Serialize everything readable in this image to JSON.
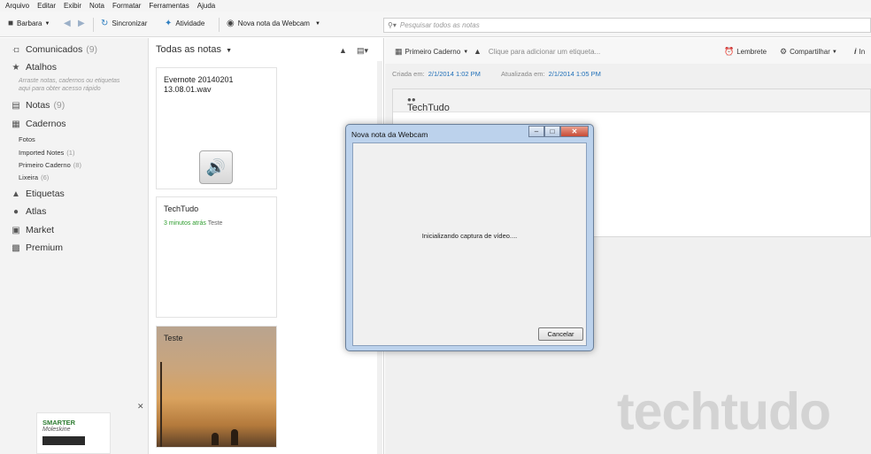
{
  "menu": [
    "Arquivo",
    "Editar",
    "Exibir",
    "Nota",
    "Formatar",
    "Ferramentas",
    "Ajuda"
  ],
  "toolbar": {
    "user": "Barbara",
    "sync": "Sincronizar",
    "activity": "Atividade",
    "webcam_note": "Nova nota da Webcam",
    "search_placeholder": "Pesquisar todos as notas"
  },
  "sidebar": {
    "comunicados": {
      "label": "Comunicados",
      "count": "(9)"
    },
    "atalhos": {
      "label": "Atalhos",
      "hint": "Arraste notas, cadernos ou etiquetas aqui para obter acesso rápido"
    },
    "notas": {
      "label": "Notas",
      "count": "(9)"
    },
    "cadernos": {
      "label": "Cadernos"
    },
    "notebooks": [
      {
        "label": "Fotos",
        "count": ""
      },
      {
        "label": "Imported Notes",
        "count": "(1)"
      },
      {
        "label": "Primeiro Caderno",
        "count": "(8)"
      },
      {
        "label": "Lixeira",
        "count": "(6)"
      }
    ],
    "etiquetas": {
      "label": "Etiquetas"
    },
    "atlas": {
      "label": "Atlas"
    },
    "market": {
      "label": "Market"
    },
    "premium": {
      "label": "Premium"
    },
    "promo": {
      "line1": "SMARTER",
      "line2": "Moleskine"
    }
  },
  "notelist": {
    "title": "Todas as notas",
    "notes": [
      {
        "title": "Evernote 20140201 13.08.01.wav",
        "meta_time": "",
        "meta_text": ""
      },
      {
        "title": "TechTudo",
        "meta_time": "3 minutos atrás",
        "meta_text": "Teste"
      },
      {
        "title": "Teste",
        "meta_time": "",
        "meta_text": ""
      }
    ]
  },
  "editor": {
    "notebook": "Primeiro Caderno",
    "tag_placeholder": "Clique para adicionar um etiqueta...",
    "reminder": "Lembrete",
    "share": "Compartilhar",
    "info": "In",
    "created_label": "Criada em:",
    "created_value": "2/1/2014 1:02 PM",
    "updated_label": "Atualizada em:",
    "updated_value": "2/1/2014 1:05 PM",
    "note_title": "TechTudo",
    "watermark": "techtudo"
  },
  "dialog": {
    "title": "Nova nota da Webcam",
    "message": "Inicializando captura de vídeo....",
    "cancel": "Cancelar"
  }
}
